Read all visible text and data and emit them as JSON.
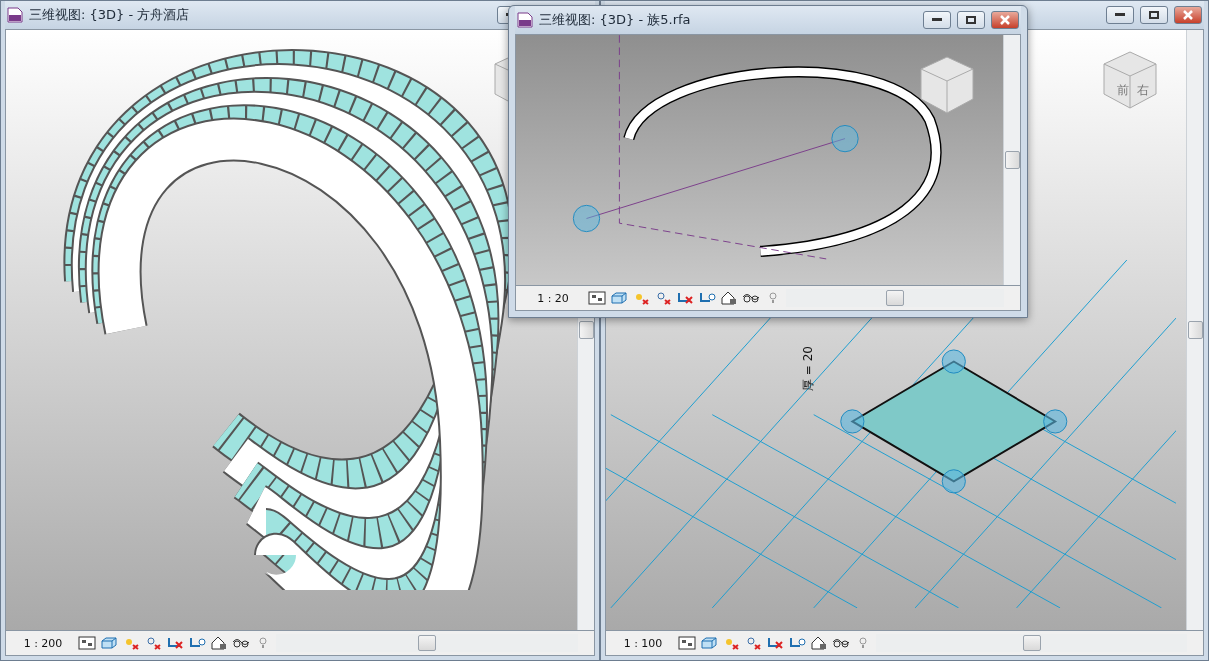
{
  "tiled_windows": [
    {
      "kind": "building",
      "title": "三维视图: {3D} - 方舟酒店",
      "scale": "1 : 200"
    },
    {
      "kind": "plate",
      "scale": "1 : 100",
      "dimension_label": "厚 = 20",
      "cube_labels": [
        "前",
        "右"
      ]
    }
  ],
  "floating_window": {
    "kind": "ring",
    "title": "三维视图: {3D} - 族5.rfa",
    "scale": "1 : 20"
  }
}
